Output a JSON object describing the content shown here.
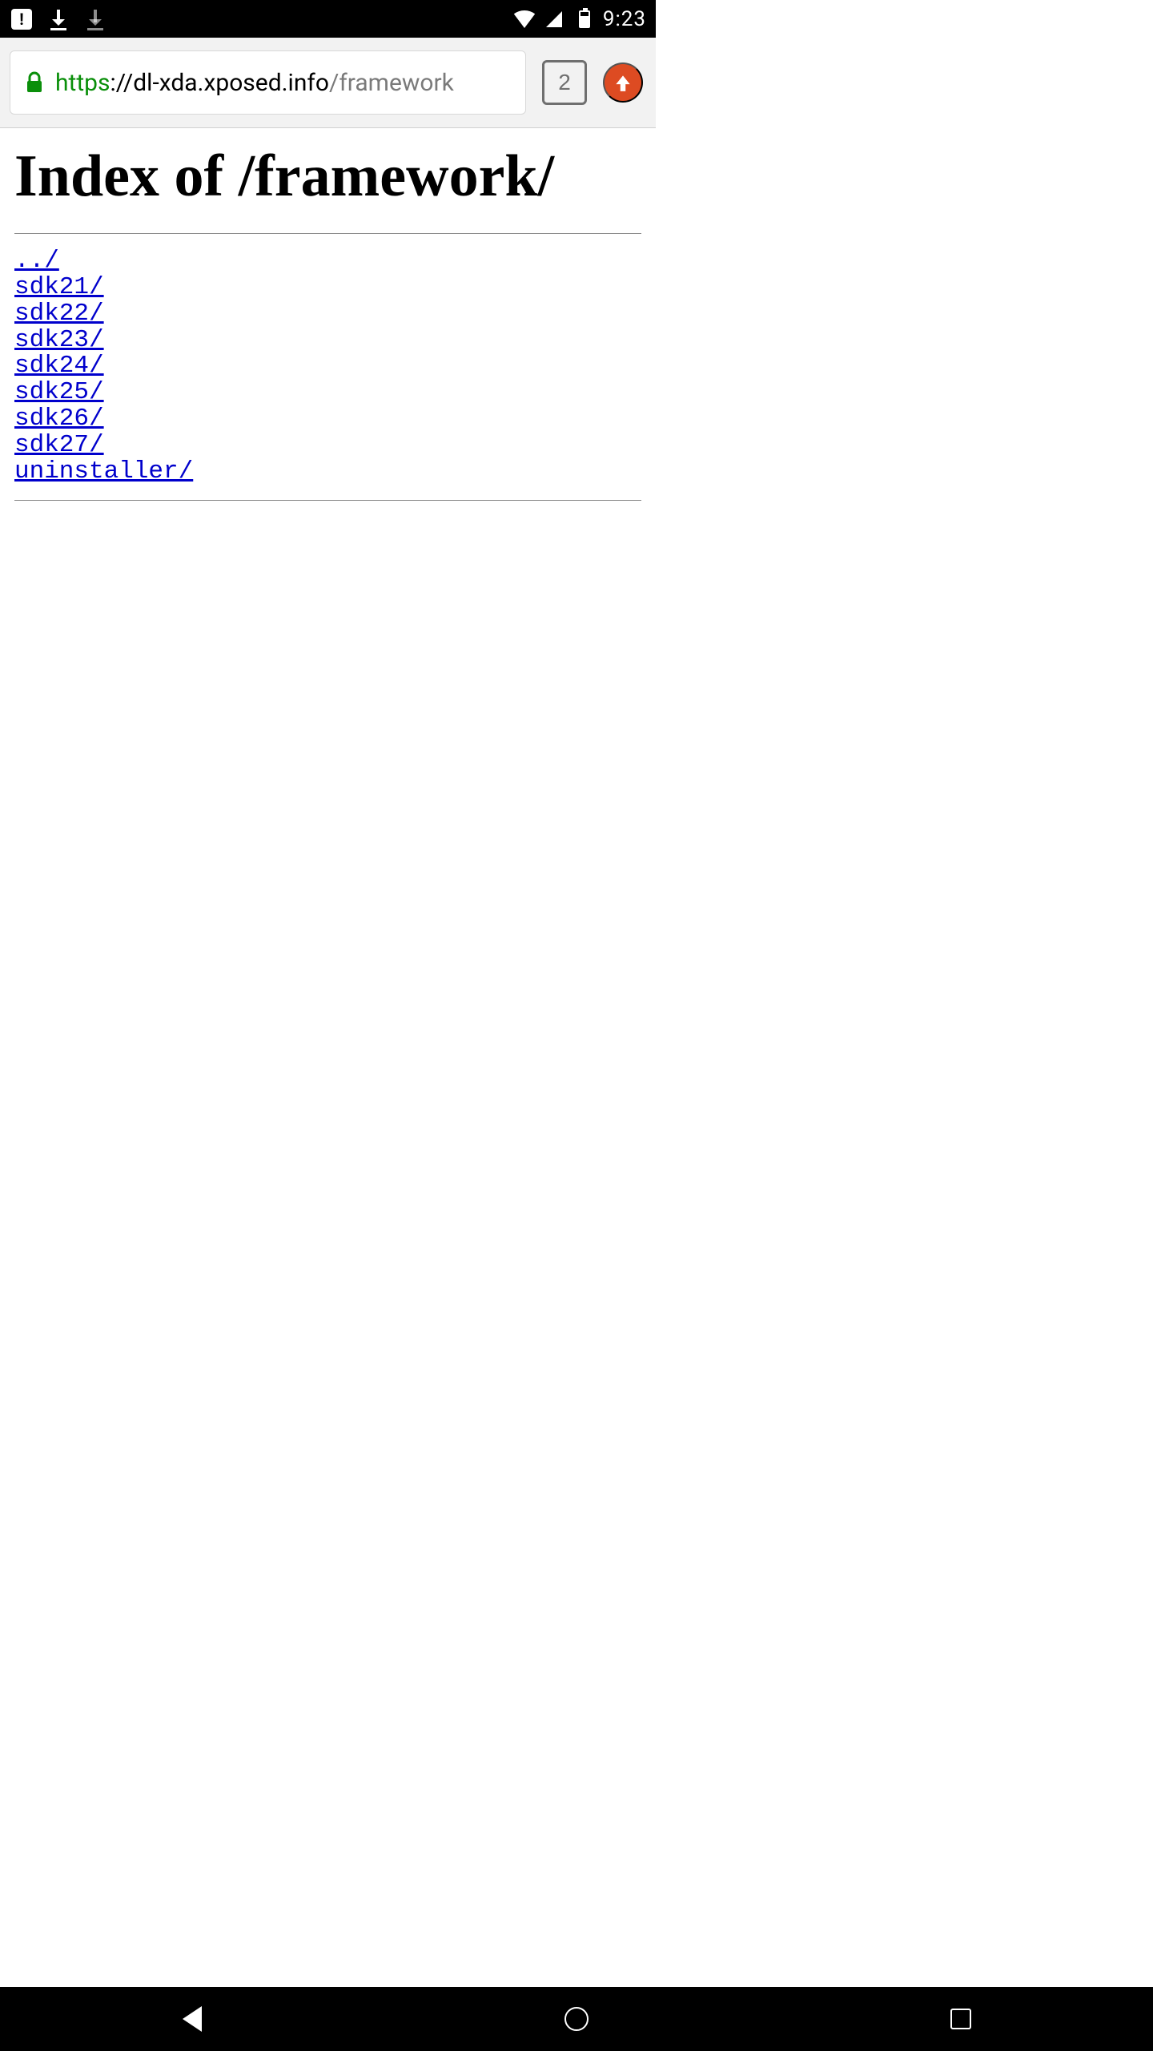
{
  "status_bar": {
    "time": "9:23"
  },
  "toolbar": {
    "url_protocol": "https",
    "url_host": "://dl-xda.xposed.info",
    "url_path": "/framework",
    "tab_count": "2"
  },
  "page": {
    "heading": "Index of /framework/",
    "links": [
      "../",
      "sdk21/",
      "sdk22/",
      "sdk23/",
      "sdk24/",
      "sdk25/",
      "sdk26/",
      "sdk27/",
      "uninstaller/"
    ]
  }
}
